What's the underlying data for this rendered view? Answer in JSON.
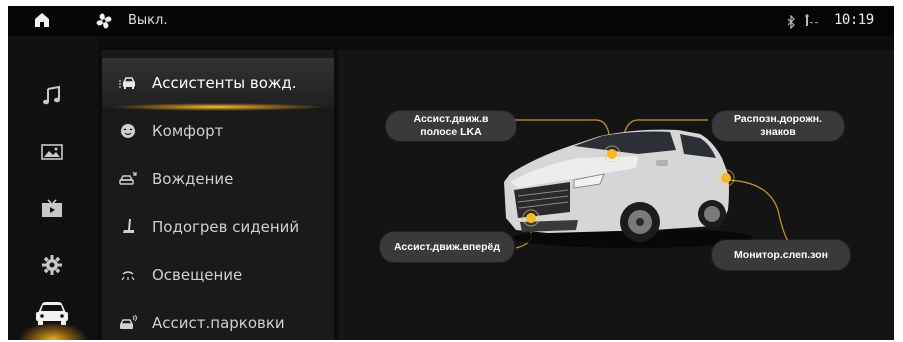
{
  "status_bar": {
    "fan_status": "Выкл.",
    "time": "10:19"
  },
  "rail": {
    "items": [
      "music-icon",
      "gallery-icon",
      "video-icon",
      "settings-icon",
      "car-icon"
    ],
    "active": "car-icon",
    "accent_color": "#f5b928"
  },
  "menu": {
    "items": [
      {
        "label": "Ассистенты вожд.",
        "icon": "driver-assist-icon",
        "active": true
      },
      {
        "label": "Комфорт",
        "icon": "comfort-icon",
        "active": false
      },
      {
        "label": "Вождение",
        "icon": "driving-icon",
        "active": false
      },
      {
        "label": "Подогрев сидений",
        "icon": "seat-heating-icon",
        "active": false
      },
      {
        "label": "Освещение",
        "icon": "lighting-icon",
        "active": false
      },
      {
        "label": "Ассист.парковки",
        "icon": "parking-assist-icon",
        "active": false
      }
    ]
  },
  "features": {
    "lka": "Ассист.движ.в полосе LKA",
    "lka_line1": "Ассист.движ.в",
    "lka_line2": "полосе LKA",
    "tsr_line1": "Распозн.дорожн.",
    "tsr_line2": "знаков",
    "forward": "Ассист.движ.вперёд",
    "blind_spot": "Монитор.слеп.зон"
  },
  "colors": {
    "highlight": "#f5b928",
    "bubble_bg": "#3a3a3a",
    "background": "#141414"
  }
}
